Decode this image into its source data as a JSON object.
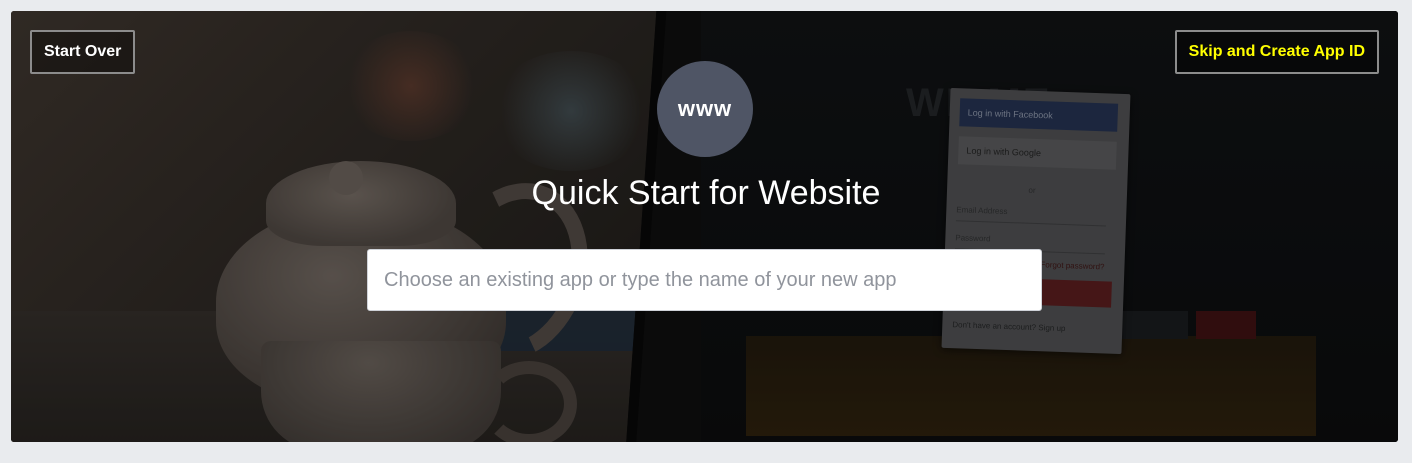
{
  "header": {
    "start_over_label": "Start Over",
    "skip_label": "Skip and Create App ID"
  },
  "hero": {
    "icon_text": "www",
    "title": "Quick Start for Website"
  },
  "app_name_input": {
    "placeholder": "Choose an existing app or type the name of your new app",
    "value": ""
  },
  "background_screen": {
    "welcome_text": "WE    ME",
    "facebook_login": "Log in with Facebook",
    "google_login": "Log in with Google",
    "or_text": "or",
    "email_placeholder": "Email Address",
    "password_placeholder": "Password",
    "forgot_text": "Forgot password?",
    "signup_text": "Don't have an account? Sign up"
  },
  "colors": {
    "page_background": "#e9ebee",
    "skip_text": "#ffff00",
    "icon_circle": "#4f5565"
  }
}
